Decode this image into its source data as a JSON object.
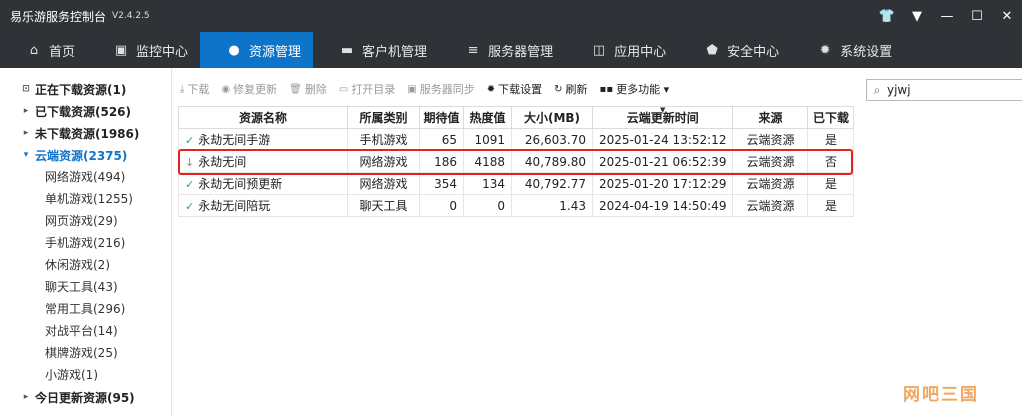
{
  "app": {
    "title": "易乐游服务控制台",
    "version": "V2.4.2.5"
  },
  "nav": [
    {
      "label": "首页",
      "icon": "⌂"
    },
    {
      "label": "监控中心",
      "icon": "▣"
    },
    {
      "label": "资源管理",
      "icon": "●"
    },
    {
      "label": "客户机管理",
      "icon": "▬"
    },
    {
      "label": "服务器管理",
      "icon": "≡"
    },
    {
      "label": "应用中心",
      "icon": "◫"
    },
    {
      "label": "安全中心",
      "icon": "⬟"
    },
    {
      "label": "系统设置",
      "icon": "✹"
    }
  ],
  "sidebar": {
    "nodes": [
      {
        "label": "正在下载资源(1)",
        "arrow": "⊡"
      },
      {
        "label": "已下载资源(526)",
        "arrow": "▸"
      },
      {
        "label": "未下载资源(1986)",
        "arrow": "▸"
      },
      {
        "label": "云端资源(2375)",
        "arrow": "▾"
      }
    ],
    "children": [
      "网络游戏(494)",
      "单机游戏(1255)",
      "网页游戏(29)",
      "手机游戏(216)",
      "休闲游戏(2)",
      "聊天工具(43)",
      "常用工具(296)",
      "对战平台(14)",
      "棋牌游戏(25)",
      "小游戏(1)"
    ],
    "last": {
      "label": "今日更新资源(95)",
      "arrow": "▸"
    }
  },
  "toolbar": [
    {
      "label": "下载",
      "icon": "⤓"
    },
    {
      "label": "修复更新",
      "icon": "◉"
    },
    {
      "label": "删除",
      "icon": "🗑"
    },
    {
      "label": "打开目录",
      "icon": "▭"
    },
    {
      "label": "服务器同步",
      "icon": "▣"
    },
    {
      "label": "下载设置",
      "icon": "✹"
    },
    {
      "label": "刷新",
      "icon": "↻"
    },
    {
      "label": "更多功能 ▾",
      "icon": "▪▪"
    }
  ],
  "search": {
    "value": "yjwj"
  },
  "table": {
    "headers": [
      "资源名称",
      "所属类别",
      "期待值",
      "热度值",
      "大小(MB)",
      "云端更新时间",
      "来源",
      "已下载"
    ],
    "rows": [
      {
        "status": "✓",
        "name": "永劫无间手游",
        "category": "手机游戏",
        "expect": "65",
        "heat": "1091",
        "size": "26,603.70",
        "time": "2025-01-24 13:52:12",
        "source": "云端资源",
        "downloaded": "是"
      },
      {
        "status": "↓",
        "name": "永劫无间",
        "category": "网络游戏",
        "expect": "186",
        "heat": "4188",
        "size": "40,789.80",
        "time": "2025-01-21 06:52:39",
        "source": "云端资源",
        "downloaded": "否"
      },
      {
        "status": "✓",
        "name": "永劫无间预更新",
        "category": "网络游戏",
        "expect": "354",
        "heat": "134",
        "size": "40,792.77",
        "time": "2025-01-20 17:12:29",
        "source": "云端资源",
        "downloaded": "是"
      },
      {
        "status": "✓",
        "name": "永劫无间陪玩",
        "category": "聊天工具",
        "expect": "0",
        "heat": "0",
        "size": "1.43",
        "time": "2024-04-19 14:50:49",
        "source": "云端资源",
        "downloaded": "是"
      }
    ]
  },
  "watermark": "网吧三国"
}
